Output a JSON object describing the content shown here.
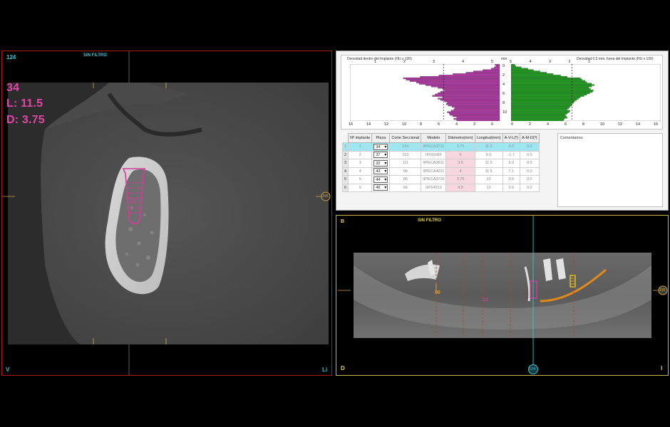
{
  "left_view": {
    "slice_number": "124",
    "filter_label": "SIN FILTRO",
    "tooth_label": "34",
    "length_label": "L: 11.5",
    "diameter_label": "D: 3.75",
    "implant_tag": "34",
    "marker_right": "100",
    "corner_bottom_left": "V",
    "corner_bottom_right": "Li"
  },
  "histograms": {
    "left_title": "Densidad dentro del Implante (HU x 100)",
    "right_title": "Densidad 0.5 mm. fuera del Implante (HU x 100)",
    "mm_label": "mm",
    "left_top_ticks": [
      "1",
      "2",
      "3",
      "4",
      "5"
    ],
    "right_top_ticks": [
      "5",
      "4",
      "3",
      "2",
      "1"
    ],
    "mm_ticks": [
      "0",
      "2",
      "4",
      "6",
      "8",
      "10"
    ],
    "left_bottom_ticks": [
      "16",
      "14",
      "12",
      "10",
      "8",
      "6",
      "4",
      "2",
      "0"
    ],
    "right_bottom_ticks": [
      "0",
      "2",
      "4",
      "6",
      "8",
      "10",
      "12",
      "14",
      "16"
    ],
    "left_color": "#b43aa8",
    "right_color": "#1fa01f"
  },
  "chart_data": [
    {
      "type": "bar",
      "title": "Densidad dentro del Implante (HU x 100)",
      "orientation": "horizontal",
      "xlim": [
        0,
        16
      ],
      "ylabel": "mm",
      "values": [
        0.5,
        0.4,
        0.6,
        0.9,
        1.8,
        2.8,
        3.6,
        5.0,
        6.5,
        8.5,
        10.3,
        10.0,
        9.6,
        8.9,
        8.6,
        7.9,
        7.3,
        6.6,
        6.1,
        5.9,
        6.3,
        6.6,
        6.9,
        7.2,
        6.1,
        6.6,
        6.3,
        5.9,
        5.6,
        5.7,
        5.5,
        5.1,
        4.8,
        4.9,
        5.2,
        5.6,
        5.4,
        5.3,
        5.0,
        4.6,
        4.9,
        4.6
      ],
      "reference": 6.0
    },
    {
      "type": "bar",
      "title": "Densidad 0.5 mm. fuera del Implante (HU x 100)",
      "orientation": "horizontal",
      "xlim": [
        0,
        16
      ],
      "ylabel": "mm",
      "values": [
        0.4,
        0.5,
        1.1,
        1.8,
        2.4,
        3.1,
        3.8,
        4.5,
        5.3,
        6.0,
        7.4,
        7.6,
        7.9,
        8.1,
        8.6,
        8.9,
        8.6,
        8.3,
        8.5,
        8.8,
        8.7,
        8.4,
        8.1,
        7.8,
        7.4,
        7.2,
        7.0,
        6.8,
        6.7,
        6.5,
        6.5,
        6.3,
        6.2,
        6.0,
        6.3,
        6.2,
        6.0,
        5.8,
        5.9,
        6.0,
        5.7,
        5.6
      ],
      "reference": 6.5
    }
  ],
  "table": {
    "headers": [
      "Nº implante",
      "Pieza",
      "Corte Seccional",
      "Modelo",
      "Diámetro(mm)",
      "Longitud(mm)",
      "A-V-L(º)",
      "A-M-D(º)"
    ],
    "rows": [
      {
        "row": "1",
        "num": "1",
        "piece": "34",
        "corte": "124",
        "modelo": "IIPECA3711",
        "diam": "3.75",
        "long": "11.5",
        "avl": "0.0",
        "amd": "0.0"
      },
      {
        "row": "2",
        "num": "2",
        "piece": "37",
        "corte": "153",
        "modelo": "IIPS5085",
        "diam": "5",
        "long": "8.5",
        "avl": "-1.7",
        "amd": "0.0"
      },
      {
        "row": "3",
        "num": "3",
        "piece": "32",
        "corte": "111",
        "modelo": "IIPECA3511",
        "diam": "3.5",
        "long": "11.5",
        "avl": "5.3",
        "amd": "0.0"
      },
      {
        "row": "4",
        "num": "4",
        "piece": "43",
        "corte": "98",
        "modelo": "IIPECA4011",
        "diam": "4",
        "long": "11.5",
        "avl": "7.1",
        "amd": "0.0"
      },
      {
        "row": "5",
        "num": "5",
        "piece": "44",
        "corte": "86",
        "modelo": "IIPECA3710",
        "diam": "3.75",
        "long": "10",
        "avl": "0.0",
        "amd": "0.0"
      },
      {
        "row": "6",
        "num": "6",
        "piece": "46",
        "corte": "66",
        "modelo": "IIPS4510",
        "diam": "4.5",
        "long": "10",
        "avl": "0.0",
        "amd": "0.0"
      }
    ],
    "comments_label": "Comentarios:"
  },
  "pano_view": {
    "corner_top_left": "B",
    "filter_label": "SIN FILTRO",
    "marker_right": "100",
    "corner_bottom_left": "D",
    "corner_bottom_right": "I",
    "slice_marker": "124",
    "label_left": "90",
    "label_center": "13"
  }
}
